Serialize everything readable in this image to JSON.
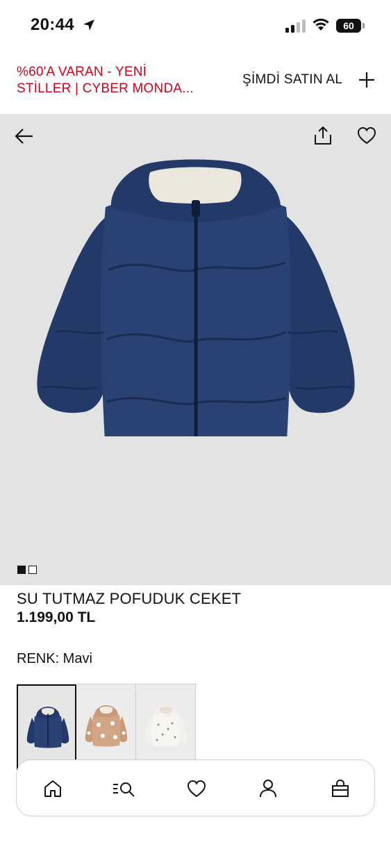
{
  "status_bar": {
    "time": "20:44",
    "battery": "60"
  },
  "promo": {
    "line1": "%60'A VARAN - YENİ",
    "line2": "STİLLER | CYBER MONDA...",
    "cta": "ŞİMDİ SATIN AL"
  },
  "gallery": {
    "image_count": 2,
    "active_index": 1
  },
  "product": {
    "name": "SU TUTMAZ POFUDUK CEKET",
    "price": "1.199,00 TL",
    "color_label": "RENK: Mavi"
  },
  "colors": {
    "jacket_main": "#233a68",
    "jacket_dark": "#1a2c52",
    "lining": "#ece7dc",
    "promo_red": "#d0021b",
    "image_bg": "#e3e3e3"
  },
  "swatches": [
    {
      "name": "Mavi",
      "selected": true
    },
    {
      "name": "Bej desenli",
      "selected": false
    },
    {
      "name": "Krem desenli",
      "selected": false
    }
  ],
  "bottom_nav": [
    "home-icon",
    "search-icon",
    "heart-icon",
    "account-icon",
    "bag-icon"
  ]
}
